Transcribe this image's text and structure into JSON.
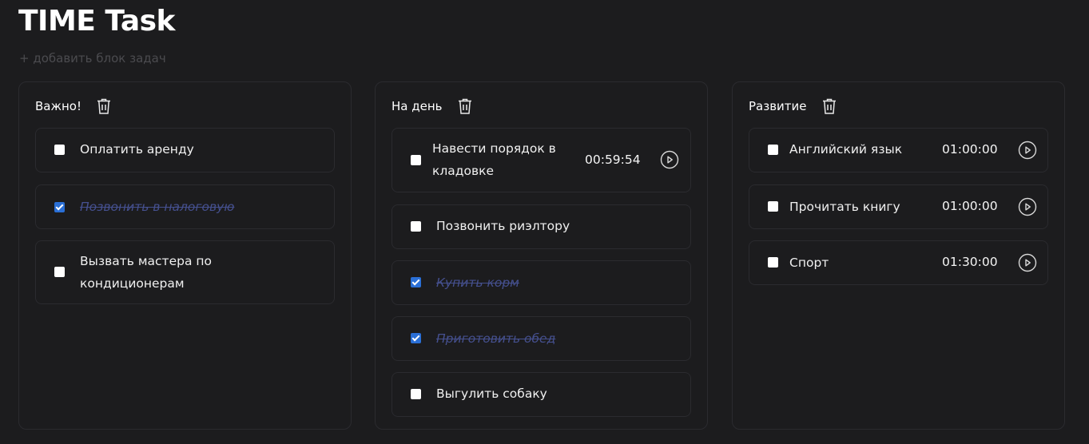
{
  "app": {
    "title": "TIME Task",
    "add_block_label": "+ добавить блок задач"
  },
  "columns": [
    {
      "title": "Важно!",
      "tasks": [
        {
          "label": "Оплатить аренду",
          "checked": false
        },
        {
          "label": "Позвонить в налоговую",
          "checked": true
        },
        {
          "label": "Вызвать мастера по кондиционерам",
          "checked": false
        }
      ]
    },
    {
      "title": "На день",
      "tasks": [
        {
          "label": "Навести порядок в кладовке",
          "checked": false,
          "timer": "00:59:54"
        },
        {
          "label": "Позвонить риэлтору",
          "checked": false
        },
        {
          "label": "Купить корм",
          "checked": true
        },
        {
          "label": "Приготовить обед",
          "checked": true
        },
        {
          "label": "Выгулить собаку",
          "checked": false
        }
      ]
    },
    {
      "title": "Развитие",
      "tasks": [
        {
          "label": "Английский язык",
          "checked": false,
          "timer": "01:00:00"
        },
        {
          "label": "Прочитать книгу",
          "checked": false,
          "timer": "01:00:00"
        },
        {
          "label": "Спорт",
          "checked": false,
          "timer": "01:30:00"
        }
      ]
    }
  ],
  "icons": {
    "delete": "trash-icon",
    "start_timer": "play-circle-icon"
  },
  "colors": {
    "background": "#1c1c1e",
    "checkbox_checked": "#2a6fd6",
    "done_text": "#45508f"
  }
}
